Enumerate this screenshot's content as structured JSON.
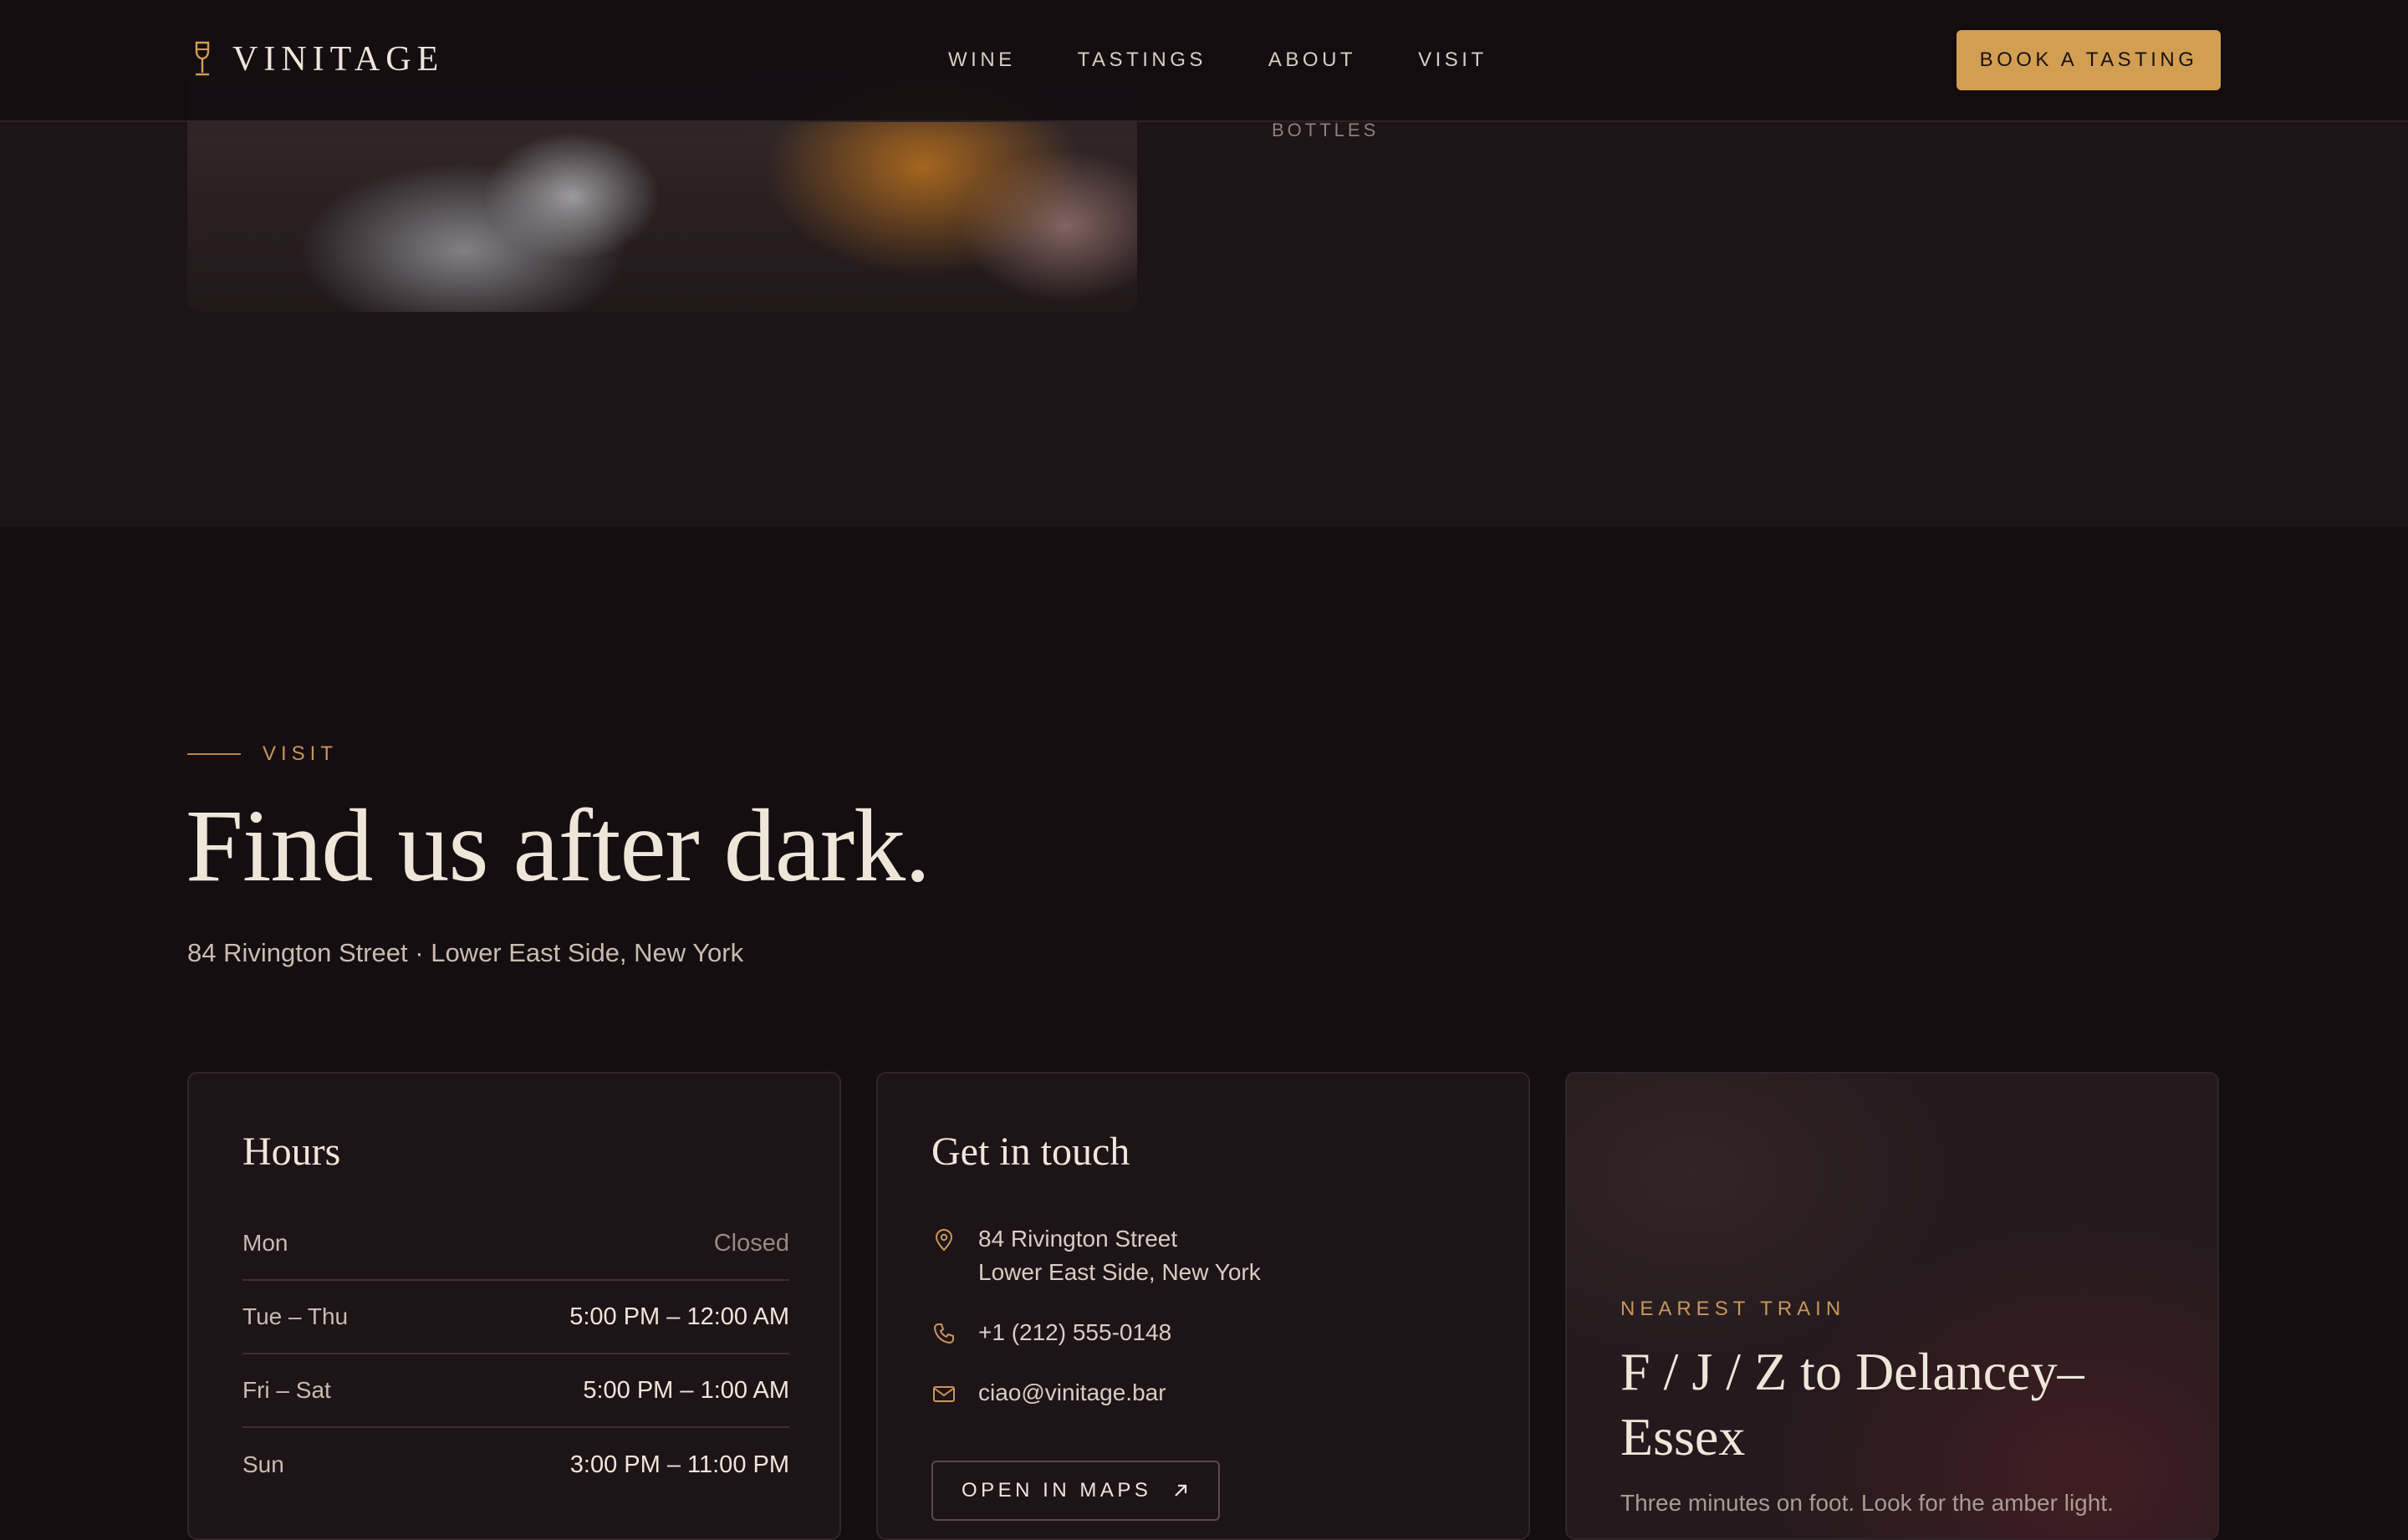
{
  "brand": {
    "name": "VINITAGE",
    "icon": "wine-glass-icon"
  },
  "nav": {
    "items": [
      {
        "label": "WINE"
      },
      {
        "label": "TASTINGS"
      },
      {
        "label": "ABOUT"
      },
      {
        "label": "VISIT"
      }
    ],
    "cta_label": "BOOK A TASTING"
  },
  "gallery": {
    "caption": "BOTTLES"
  },
  "visit": {
    "eyebrow": "VISIT",
    "headline": "Find us after dark.",
    "address_line": "84 Rivington Street · Lower East Side, New York"
  },
  "hours_card": {
    "title": "Hours",
    "rows": [
      {
        "day": "Mon",
        "time": "Closed"
      },
      {
        "day": "Tue – Thu",
        "time": "5:00 PM – 12:00 AM"
      },
      {
        "day": "Fri – Sat",
        "time": "5:00 PM – 1:00 AM"
      },
      {
        "day": "Sun",
        "time": "3:00 PM – 11:00 PM"
      }
    ]
  },
  "contact_card": {
    "title": "Get in touch",
    "address_line1": "84 Rivington Street",
    "address_line2": "Lower East Side, New York",
    "phone": "+1 (212) 555-0148",
    "email": "ciao@vinitage.bar",
    "maps_label": "OPEN IN MAPS",
    "icons": [
      "map-pin-icon",
      "phone-icon",
      "mail-icon",
      "arrow-up-right-icon"
    ]
  },
  "train_card": {
    "eyebrow": "NEAREST TRAIN",
    "title": "F / J / Z to Delancey–Essex",
    "note": "Three minutes on foot. Look for the amber light."
  },
  "colors": {
    "background": "#150e11",
    "surface": "#1d1418",
    "accent": "#d29f52",
    "text": "#efe6da",
    "muted": "#c8bcb0"
  }
}
